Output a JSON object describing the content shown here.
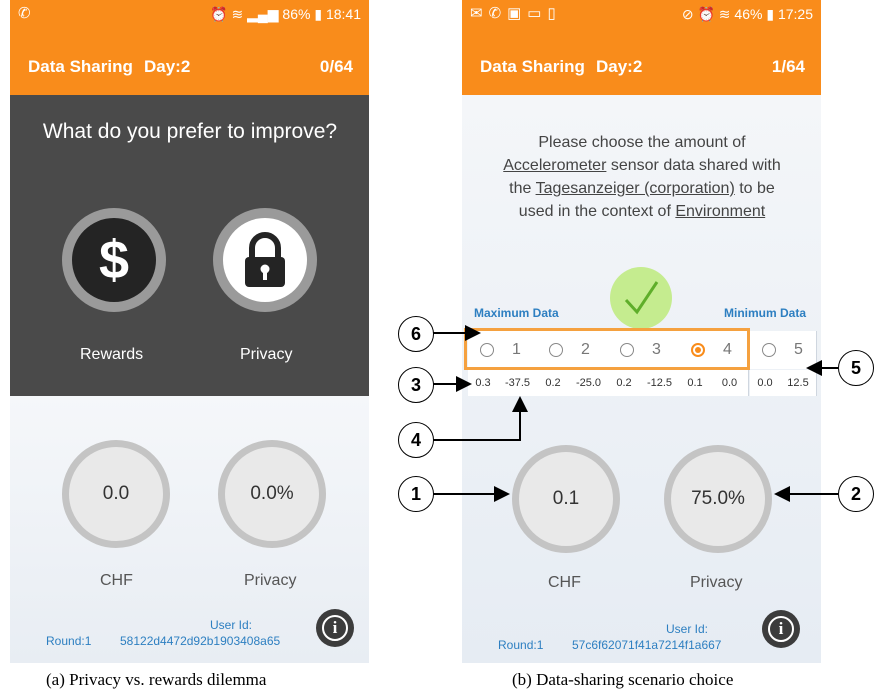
{
  "figure_a": {
    "status_time": "18:41",
    "status_battery": "86%",
    "app_title": "Data Sharing",
    "day": "Day:2",
    "progress": "0/64",
    "question": "What do you prefer to improve?",
    "option_rewards": "Rewards",
    "option_privacy": "Privacy",
    "chf_value": "0.0",
    "privacy_value": "0.0%",
    "chf_label": "CHF",
    "privacy_label": "Privacy",
    "user_id_label": "User Id:",
    "user_id": "58122d4472d92b1903408a65",
    "round": "Round:1",
    "caption": "(a) Privacy vs. rewards dilemma"
  },
  "figure_b": {
    "status_time": "17:25",
    "status_battery": "46%",
    "app_title": "Data Sharing",
    "day": "Day:2",
    "progress": "1/64",
    "prompt_pre": "Please choose the amount of",
    "prompt_sensor": "Accelerometer",
    "prompt_mid1": "sensor data shared with the",
    "prompt_org": "Tagesanzeiger (corporation)",
    "prompt_mid2": "to be used in the context of",
    "prompt_context": "Environment",
    "max_label": "Maximum Data",
    "min_label": "Minimum Data",
    "options": [
      "1",
      "2",
      "3",
      "4",
      "5"
    ],
    "selected_option": "4",
    "numbers": [
      "0.3",
      "-37.5",
      "0.2",
      "-25.0",
      "0.2",
      "-12.5",
      "0.1",
      "0.0",
      "0.0",
      "12.5"
    ],
    "chf_value": "0.1",
    "privacy_value": "75.0%",
    "chf_label": "CHF",
    "privacy_label": "Privacy",
    "user_id_label": "User Id:",
    "user_id": "57c6f62071f41a7214f1a667",
    "round": "Round:1",
    "caption": "(b) Data-sharing scenario choice"
  },
  "markers": [
    "1",
    "2",
    "3",
    "4",
    "5",
    "6"
  ],
  "colors": {
    "orange": "#f98c1b",
    "dark": "#4a4a4a",
    "link_blue": "#2d7fc1",
    "check_green": "#c5ec8f"
  }
}
